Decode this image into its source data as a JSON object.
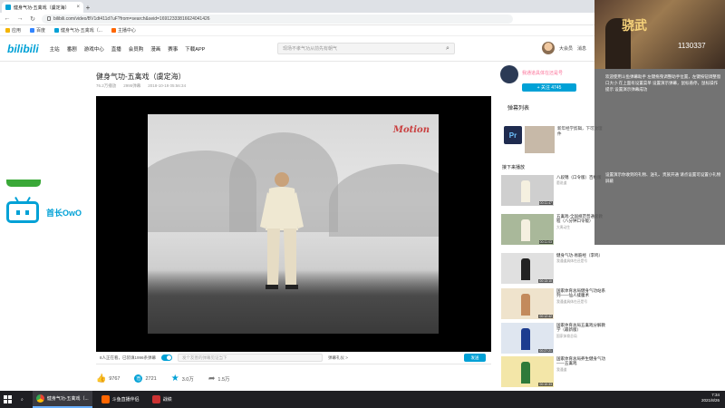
{
  "browser": {
    "tab_title": "健身气功-五禽戏（虞定海）",
    "url": "bilibili.com/video/BV1dt411d7uF?from=search&seid=16912333816624041426",
    "bookmarks": [
      "应用",
      "百度",
      "健身气功-五禽戏（...",
      "主播中心"
    ]
  },
  "header": {
    "logo": "bilibili",
    "nav": [
      "主站",
      "番剧",
      "游戏中心",
      "直播",
      "会员购",
      "漫画",
      "赛事",
      "下载APP"
    ],
    "search_placeholder": "现场不孝气功从前先有朝气",
    "right": [
      "大会员",
      "消息"
    ]
  },
  "video": {
    "title": "健身气功-五禽戏（虞定海）",
    "views": "76.2万播放",
    "danmaku": "2995弹幕",
    "date": "2018-10-19 05:56:34",
    "watermark": "Motion"
  },
  "controls": {
    "online": "8人正在看，已装填1996条弹幕",
    "danmaku_placeholder": "发个友善的弹幕见证当下",
    "etiquette": "弹幕礼仪 >",
    "send": "发送"
  },
  "actions": {
    "like": "9767",
    "coin": "2721",
    "fav": "3.0万",
    "share": "1.5万"
  },
  "uploader": {
    "name": "我通道具体在还是号",
    "follow": "+ 关注 4745"
  },
  "sidebar": {
    "danmaku_list": "弹幕列表",
    "autoplay_heading": "接下来播放",
    "ad_text": "新年经学剪辑，下可放理件",
    "reco": [
      {
        "title": "八段锦（口令版）百姓版",
        "author": "蕙说道",
        "duration": "00:11:47"
      },
      {
        "title": "五禽戏-全国规范普通套教程（八分钟口令版）",
        "author": "大禹动生",
        "duration": "00:11:03"
      },
      {
        "title": "健身气功-易筋经（李鸣）",
        "author": "我通道具体在还是号",
        "duration": "00:13:10"
      },
      {
        "title": "国家体育总局健身气功站系列——仙人揉腹术",
        "author": "我通道具体在还是号",
        "duration": "00:12:42"
      },
      {
        "title": "国家体育总局五禽戏分解教学（最新版）",
        "author": "国家体育总局",
        "duration": "00:27:21"
      },
      {
        "title": "国家体育总局养生健身气功——五禽戏",
        "author": "我通道",
        "duration": "00:10:33"
      }
    ]
  },
  "left_widget": {
    "label": "首长OwO"
  },
  "overlay": {
    "brand": "骁武",
    "number": "1130337",
    "message1": "欢迎使用斗鱼弹幕助手 左键拖曳调整助手位置，左键按钮调整窗口大小 在上面有设置菜单 设置演示弹幕，鼠标悬停，鼠标操作提示 设置演示弹幕成功",
    "message2": "设置演示你收到的礼物、送礼、贵族开通 请点设置可设置小礼物屏蔽"
  },
  "taskbar": {
    "apps": [
      "健身气功-五禽戏（...",
      "斗鱼直播伴侣",
      "战绩"
    ],
    "time": "7:34",
    "date": "2021/8/26"
  },
  "colors": {
    "accent": "#00a1d6",
    "pink": "#fb7299"
  }
}
